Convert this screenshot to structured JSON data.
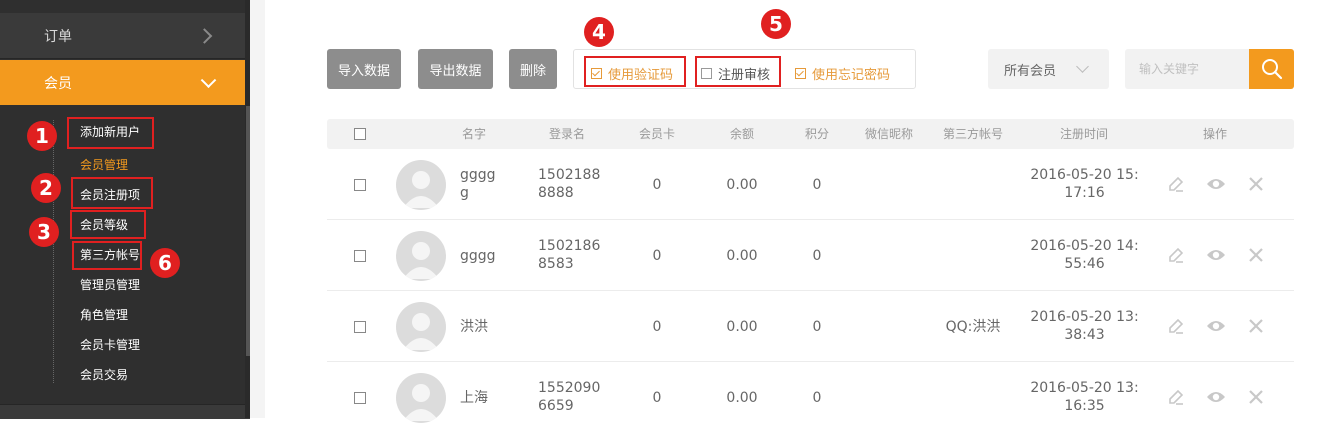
{
  "sidebar": {
    "order_label": "订单",
    "member_label": "会员",
    "subitems": [
      "添加新用户",
      "会员管理",
      "会员注册项",
      "会员等级",
      "第三方帐号",
      "管理员管理",
      "角色管理",
      "会员卡管理",
      "会员交易"
    ],
    "active_index": 1
  },
  "annotations": [
    "1",
    "2",
    "3",
    "4",
    "5",
    "6"
  ],
  "toolbar": {
    "import_label": "导入数据",
    "export_label": "导出数据",
    "delete_label": "删除",
    "opt_captcha": {
      "label": "使用验证码",
      "checked": true
    },
    "opt_review": {
      "label": "注册审核",
      "checked": false
    },
    "opt_forgot": {
      "label": "使用忘记密码",
      "checked": true
    },
    "filter_selected": "所有会员",
    "search_placeholder": "输入关键字"
  },
  "table": {
    "columns": [
      "名字",
      "登录名",
      "会员卡",
      "余额",
      "积分",
      "微信昵称",
      "第三方帐号",
      "注册时间",
      "操作"
    ],
    "rows": [
      {
        "name1": "gggg",
        "name2": "g",
        "login1": "1502188",
        "login2": "8888",
        "card": "0",
        "balance": "0.00",
        "points": "0",
        "wechat": "",
        "third": "",
        "date": "2016-05-20 15:",
        "time": "17:16"
      },
      {
        "name1": "gggg",
        "name2": "",
        "login1": "1502186",
        "login2": "8583",
        "card": "0",
        "balance": "0.00",
        "points": "0",
        "wechat": "",
        "third": "",
        "date": "2016-05-20 14:",
        "time": "55:46"
      },
      {
        "name1": "洪洪",
        "name2": "",
        "login1": "",
        "login2": "",
        "card": "0",
        "balance": "0.00",
        "points": "0",
        "wechat": "",
        "third": "QQ:洪洪",
        "date": "2016-05-20 13:",
        "time": "38:43"
      },
      {
        "name1": "上海",
        "name2": "",
        "login1": "1552090",
        "login2": "6659",
        "card": "0",
        "balance": "0.00",
        "points": "0",
        "wechat": "",
        "third": "",
        "date": "2016-05-20 13:",
        "time": "16:35"
      }
    ]
  },
  "icons": {
    "edit": "edit-icon",
    "view": "eye-icon",
    "delete": "close-icon",
    "search": "search-icon"
  },
  "colors": {
    "accent": "#f39a1e",
    "annotation_red": "#e02020",
    "sidebar_bg": "#2f2f2f"
  }
}
